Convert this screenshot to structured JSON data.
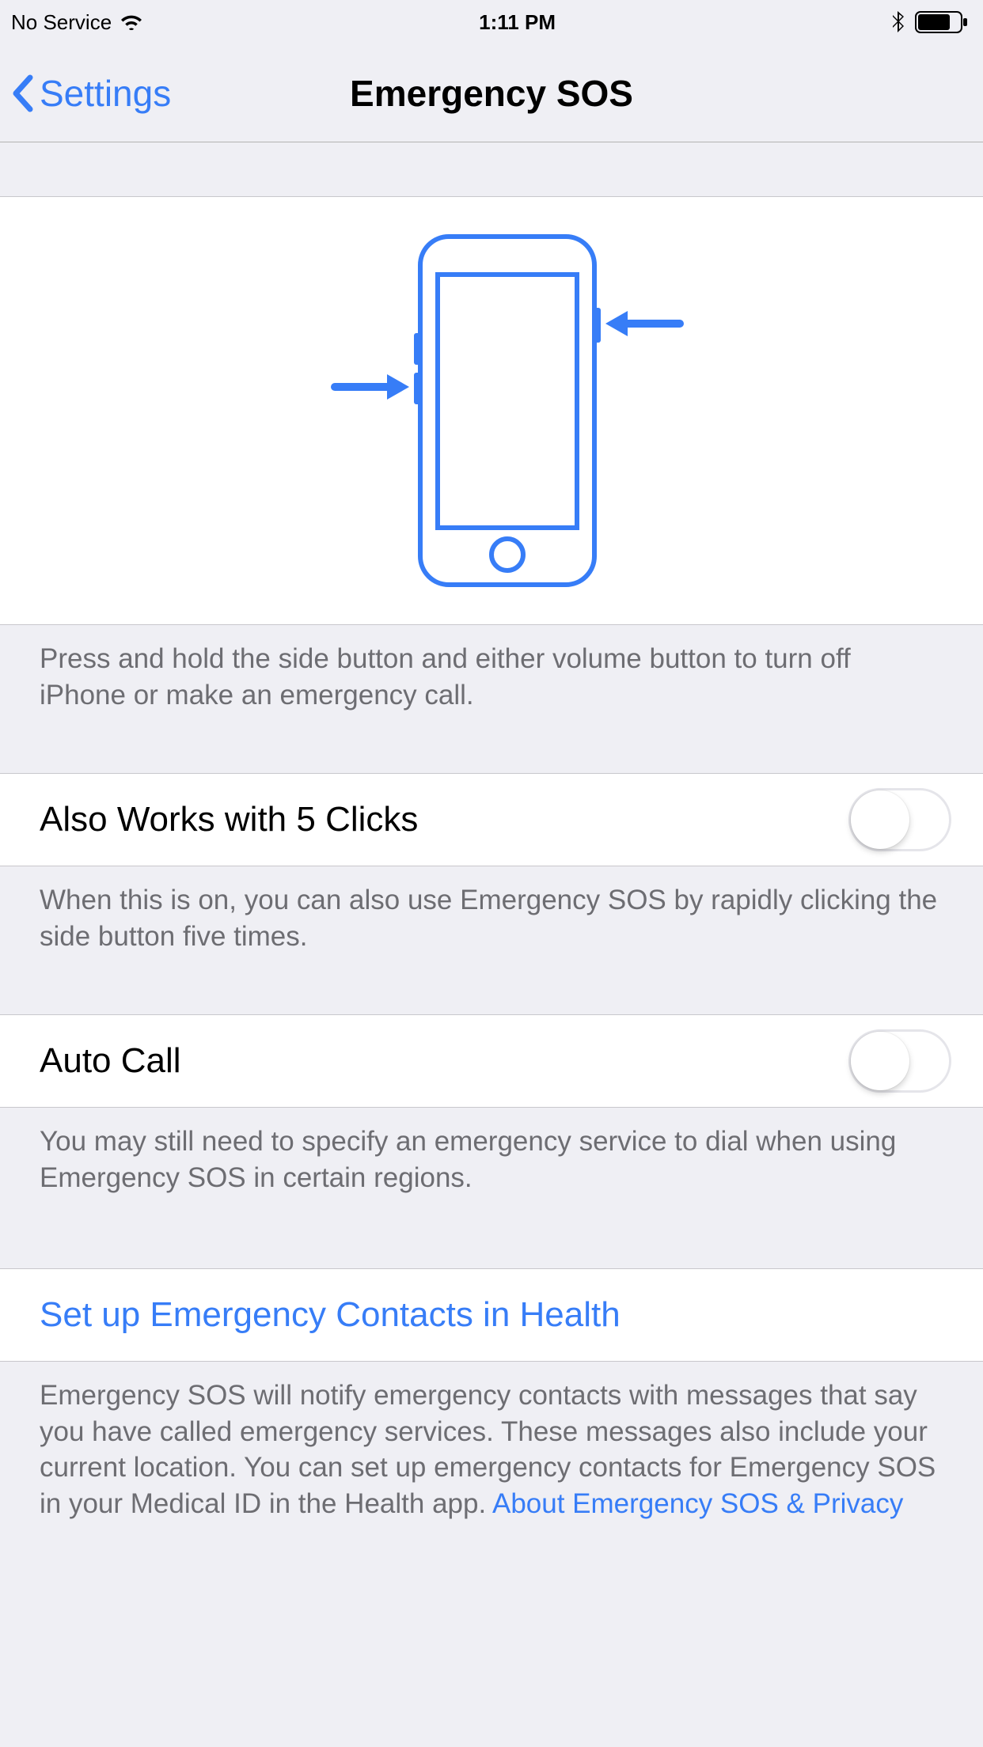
{
  "status": {
    "carrier": "No Service",
    "time": "1:11 PM"
  },
  "nav": {
    "back_label": "Settings",
    "title": "Emergency SOS"
  },
  "illustration": {
    "footer_text": "Press and hold the side button and either volume button to turn off iPhone or make an emergency call."
  },
  "clicks5": {
    "label": "Also Works with 5 Clicks",
    "footer_text": "When this is on, you can also use Emergency SOS by rapidly clicking the side button five times."
  },
  "autocall": {
    "label": "Auto Call",
    "footer_text": "You may still need to specify an emergency service to dial when using Emergency SOS in certain regions."
  },
  "contacts": {
    "label": "Set up Emergency Contacts in Health",
    "footer_text": "Emergency SOS will notify emergency contacts with messages that say you have called emergency services. These messages also include your current location. You can set up emergency contacts for Emergency SOS in your Medical ID in the Health app. ",
    "privacy_link": "About Emergency SOS & Privacy"
  }
}
